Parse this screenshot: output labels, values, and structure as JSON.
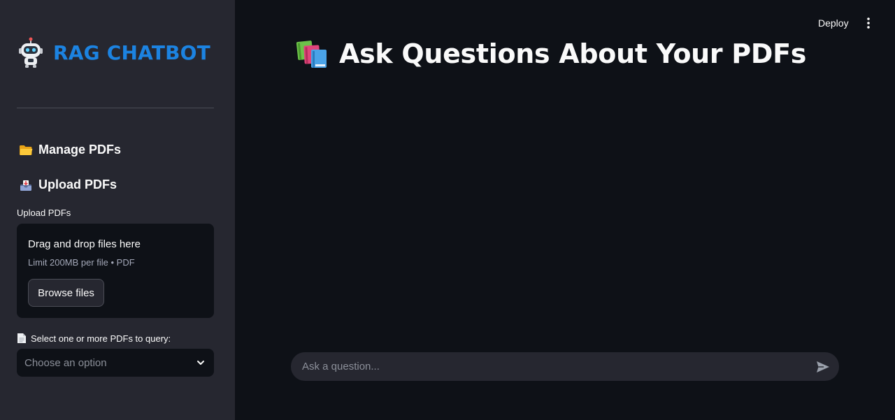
{
  "sidebar": {
    "brand_title": "RAG CHATBOT",
    "brand_icon": "robot-icon",
    "manage_heading": "Manage PDFs",
    "manage_icon": "folder-icon",
    "upload_heading": "Upload PDFs",
    "upload_icon": "inbox-tray-icon",
    "uploader": {
      "label": "Upload PDFs",
      "drop_title": "Drag and drop files here",
      "drop_limit": "Limit 200MB per file • PDF",
      "browse_label": "Browse files"
    },
    "select": {
      "label": "Select one or more PDFs to query:",
      "label_icon": "page-icon",
      "placeholder": "Choose an option"
    }
  },
  "header": {
    "deploy_label": "Deploy",
    "menu_icon": "vertical-dots-icon"
  },
  "main": {
    "title": "Ask Questions About Your PDFs",
    "title_icon": "books-icon"
  },
  "chat": {
    "placeholder": "Ask a question...",
    "send_icon": "send-icon"
  },
  "colors": {
    "sidebar_bg": "#262730",
    "main_bg": "#0e1117",
    "brand_accent": "#1c83e1",
    "text": "#fafafa",
    "muted_text": "#a3a8b8"
  }
}
